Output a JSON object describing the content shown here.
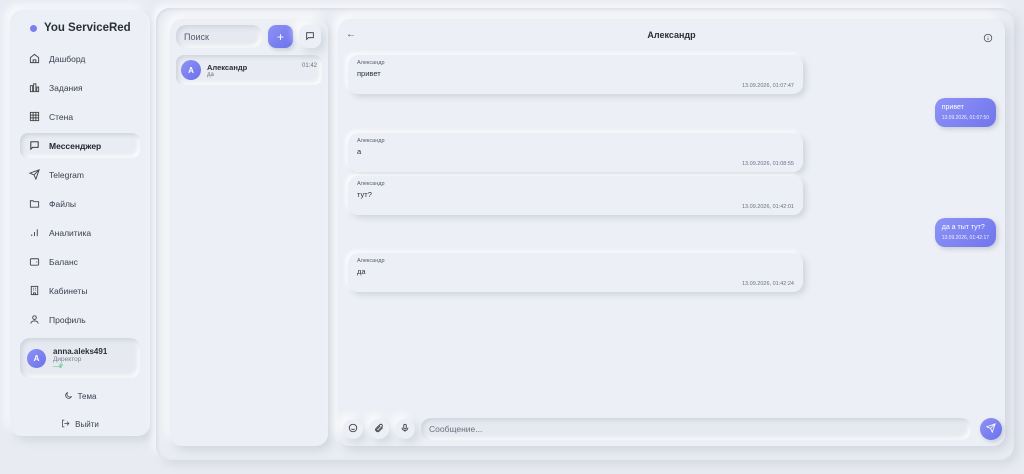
{
  "app": {
    "title": "You ServiceRed",
    "accent": "#7b7ff0"
  },
  "sidebar": {
    "items": [
      {
        "label": "Дашборд",
        "icon": "home-icon"
      },
      {
        "label": "Задания",
        "icon": "tasks-icon"
      },
      {
        "label": "Стена",
        "icon": "grid-icon"
      },
      {
        "label": "Мессенджер",
        "icon": "message-icon",
        "active": true
      },
      {
        "label": "Telegram",
        "icon": "telegram-icon"
      },
      {
        "label": "Файлы",
        "icon": "folder-icon"
      },
      {
        "label": "Аналитика",
        "icon": "analytics-icon"
      },
      {
        "label": "Баланс",
        "icon": "wallet-icon"
      },
      {
        "label": "Кабинеты",
        "icon": "building-icon"
      },
      {
        "label": "Профиль",
        "icon": "user-icon"
      }
    ],
    "user": {
      "initial": "A",
      "name": "anna.aleks491",
      "role": "Директор",
      "status": "—₽"
    },
    "theme_label": "Тема",
    "logout_label": "Выйти"
  },
  "conversations": {
    "search_placeholder": "Поиск",
    "plus_label": "+",
    "items": [
      {
        "initial": "A",
        "name": "Александр",
        "last": "да",
        "time": "01:42"
      }
    ]
  },
  "chat": {
    "title": "Александр",
    "messages": [
      {
        "author": "Александр",
        "text": "привет",
        "time": "13.09.2026, 01:07:47"
      },
      {
        "text": "привет",
        "time": "13.09.2026, 01:07:50"
      },
      {
        "author": "Александр",
        "text": "а",
        "time": "13.09.2026, 01:08:55"
      },
      {
        "author": "Александр",
        "text": "тут?",
        "time": "13.09.2026, 01:42:01"
      },
      {
        "text": "да а тыт тут?",
        "time": "13.09.2026, 01:42:17"
      },
      {
        "author": "Александр",
        "text": "да",
        "time": "13.09.2026, 01:42:24"
      }
    ],
    "input_placeholder": "Сообщение..."
  }
}
